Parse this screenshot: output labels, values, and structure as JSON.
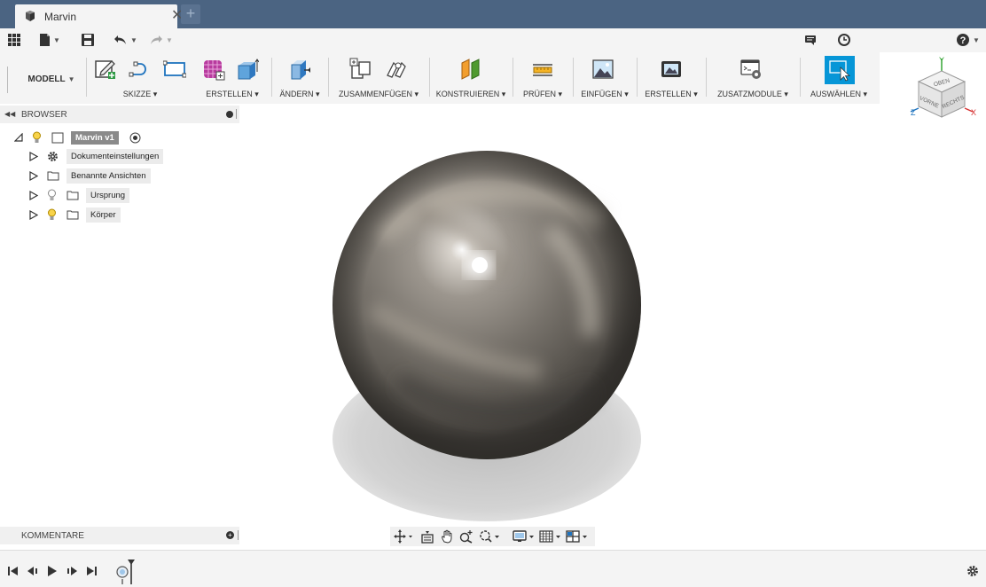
{
  "tab": {
    "title": "Marvin",
    "close": "✕",
    "new_tab": "+"
  },
  "ribbon": {
    "workspace": "MODELL",
    "groups": [
      {
        "label": "SKIZZE"
      },
      {
        "label": "ERSTELLEN"
      },
      {
        "label": "ÄNDERN"
      },
      {
        "label": "ZUSAMMENFÜGEN"
      },
      {
        "label": "KONSTRUIEREN"
      },
      {
        "label": "PRÜFEN"
      },
      {
        "label": "EINFÜGEN"
      },
      {
        "label": "ERSTELLEN"
      },
      {
        "label": "ZUSATZMODULE"
      },
      {
        "label": "AUSWÄHLEN"
      }
    ]
  },
  "browser": {
    "title": "BROWSER",
    "root": "Marvin v1",
    "items": [
      {
        "label": "Dokumenteinstellungen",
        "icon": "gear-icon"
      },
      {
        "label": "Benannte Ansichten",
        "icon": "folder-icon"
      },
      {
        "label": "Ursprung",
        "icon": "folder-icon"
      },
      {
        "label": "Körper",
        "icon": "folder-icon"
      }
    ]
  },
  "comments": {
    "title": "KOMMENTARE",
    "plus": "+"
  },
  "viewcube": {
    "top": "OBEN",
    "front": "VORNE",
    "right": "RECHTS",
    "axis_x": "X",
    "axis_y": "Y",
    "axis_z": "Z"
  },
  "colors": {
    "tabbar": "#4b6482",
    "accent": "#0696d7",
    "panel": "#f4f4f4"
  }
}
